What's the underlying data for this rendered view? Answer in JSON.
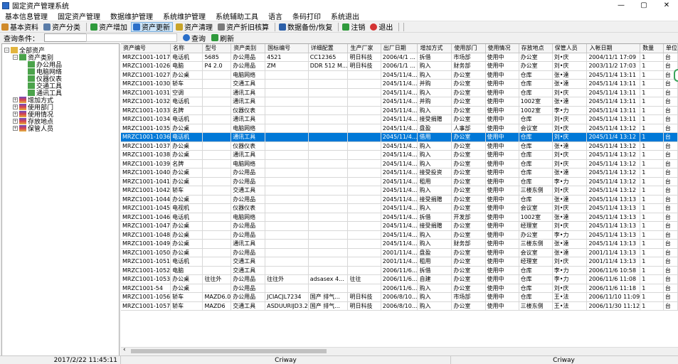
{
  "window": {
    "title": "固定资产管理系统",
    "min": "—",
    "max": "▢",
    "close": "✕"
  },
  "menu": [
    "基本信息管理",
    "固定资产管理",
    "数据维护管理",
    "系统维护管理",
    "系统辅助工具",
    "语言",
    "条码打印",
    "系统退出"
  ],
  "toolbar": [
    {
      "label": "基本资料",
      "icon": "user-group-icon",
      "color": "#d08a2a"
    },
    {
      "label": "资产分类",
      "icon": "gear-icon",
      "color": "#5a7ca8"
    },
    {
      "label": "资产增加",
      "icon": "add-box-icon",
      "color": "#2f9a3c"
    },
    {
      "label": "资产更新",
      "icon": "refresh-icon",
      "color": "#2a6fc9"
    },
    {
      "label": "资产清理",
      "icon": "cleanup-icon",
      "color": "#c8a42a"
    },
    {
      "label": "资产折旧核算",
      "icon": "calculate-icon",
      "color": "#7b7b7b"
    },
    {
      "label": "数据备份/恢复",
      "icon": "database-icon",
      "color": "#2c5fa8"
    },
    {
      "label": "注销",
      "icon": "logoff-icon",
      "color": "#2f9a3c"
    },
    {
      "label": "退出",
      "icon": "exit-icon",
      "color": "#d43333"
    }
  ],
  "query": {
    "label": "查询条件：",
    "search_label": "查询",
    "refresh_label": "刷新",
    "dropdown_arrow": "▾"
  },
  "tree": {
    "root": "全部资产",
    "category": "资产类别",
    "children": [
      "办公用品",
      "电脑网络",
      "仪器仪表",
      "交通工具",
      "通讯工具"
    ],
    "groups": [
      "增加方式",
      "使用部门",
      "使用情况",
      "存放地点",
      "保管人员"
    ]
  },
  "grid": {
    "columns": [
      "资产编号",
      "名称",
      "型号",
      "资产类别",
      "国标编号",
      "详细配置",
      "生产厂家",
      "出厂日期",
      "增加方式",
      "使用部门",
      "使用情况",
      "存放地点",
      "保管人员",
      "入帐日期",
      "数量",
      "单位"
    ],
    "selected_index": 9,
    "rows": [
      [
        "MRZC1001-1017",
        "电话机",
        "5685",
        "办公用品",
        "4521",
        "CC12365",
        "明日科技",
        "2006/4/1 ...",
        "拆借",
        "市场部",
        "使用中",
        "办公室",
        "刘•庆",
        "2004/11/1 17:09",
        "1",
        "台"
      ],
      [
        "MRZC1001-1026",
        "电脑",
        "P4 2.0",
        "办公用品",
        "ZM",
        "DDR 512 M...",
        "明日科技",
        "2006/1/1 ...",
        "购入",
        "财务部",
        "使用中",
        "办公室",
        "刘•庆",
        "2003/11/2 17:03",
        "1",
        "台"
      ],
      [
        "MRZC1001-1027",
        "办公桌",
        "",
        "电脑网络",
        "",
        "",
        "",
        "2045/11/4...",
        "购入",
        "办公室",
        "使用中",
        "仓库",
        "张•達",
        "2045/11/4 13:11",
        "1",
        "台"
      ],
      [
        "MRZC1001-1030",
        "轿车",
        "",
        "交通工具",
        "",
        "",
        "",
        "2045/11/4...",
        "并购",
        "办公室",
        "使用中",
        "仓库",
        "张•達",
        "2045/11/4 13:11",
        "1",
        "台"
      ],
      [
        "MRZC1001-1031",
        "空调",
        "",
        "通讯工具",
        "",
        "",
        "",
        "2045/11/4...",
        "购入",
        "办公室",
        "使用中",
        "仓库",
        "刘•庆",
        "2045/11/4 13:11",
        "1",
        "台"
      ],
      [
        "MRZC1001-1032",
        "电话机",
        "",
        "通讯工具",
        "",
        "",
        "",
        "2045/11/4...",
        "并购",
        "办公室",
        "使用中",
        "1002室",
        "张•達",
        "2045/11/4 13:11",
        "1",
        "台"
      ],
      [
        "MRZC1001-1033",
        "名牌",
        "",
        "仪器仪表",
        "",
        "",
        "",
        "2045/11/4...",
        "购入",
        "办公室",
        "使用中",
        "1002室",
        "李•力",
        "2045/11/4 13:11",
        "1",
        "台"
      ],
      [
        "MRZC1001-1034",
        "电话机",
        "",
        "通讯工具",
        "",
        "",
        "",
        "2045/11/4...",
        "接受捐赠",
        "办公室",
        "使用中",
        "仓库",
        "刘•庆",
        "2045/11/4 13:11",
        "1",
        "台"
      ],
      [
        "MRZC1001-1035",
        "办公桌",
        "",
        "电脑网络",
        "",
        "",
        "",
        "2045/11/4...",
        "盘盈",
        "人事部",
        "使用中",
        "会议室",
        "刘•庆",
        "2045/11/4 13:12",
        "1",
        "台"
      ],
      [
        "MRZC1001-1036",
        "电话机",
        "",
        "通讯工具",
        "",
        "",
        "",
        "2045/11/4...",
        "借用",
        "办公室",
        "使用中",
        "仓库",
        "刘•庆",
        "2045/11/4 13:12",
        "1",
        "台"
      ],
      [
        "MRZC1001-1037",
        "办公桌",
        "",
        "仪器仪表",
        "",
        "",
        "",
        "2045/11/4...",
        "购入",
        "办公室",
        "使用中",
        "仓库",
        "张•達",
        "2045/11/4 13:12",
        "1",
        "台"
      ],
      [
        "MRZC1001-1038",
        "办公桌",
        "",
        "通讯工具",
        "",
        "",
        "",
        "2045/11/4...",
        "购入",
        "办公室",
        "使用中",
        "仓库",
        "刘•庆",
        "2045/11/4 13:12",
        "1",
        "台"
      ],
      [
        "MRZC1001-1039",
        "名牌",
        "",
        "电脑网络",
        "",
        "",
        "",
        "2045/11/4...",
        "购入",
        "办公室",
        "使用中",
        "仓库",
        "刘•庆",
        "2045/11/4 13:12",
        "1",
        "台"
      ],
      [
        "MRZC1001-1040",
        "办公桌",
        "",
        "办公用品",
        "",
        "",
        "",
        "2045/11/4...",
        "接受投资",
        "办公室",
        "使用中",
        "仓库",
        "张•達",
        "2045/11/4 13:12",
        "1",
        "台"
      ],
      [
        "MRZC1001-1041",
        "办公桌",
        "",
        "办公用品",
        "",
        "",
        "",
        "2045/11/4...",
        "租用",
        "办公室",
        "使用中",
        "仓库",
        "李•力",
        "2045/11/4 13:12",
        "1",
        "台"
      ],
      [
        "MRZC1001-1042",
        "轿车",
        "",
        "交通工具",
        "",
        "",
        "",
        "2045/11/4...",
        "购入",
        "办公室",
        "使用中",
        "三楼东侧",
        "刘•庆",
        "2045/11/4 13:12",
        "1",
        "台"
      ],
      [
        "MRZC1001-1044",
        "办公桌",
        "",
        "办公用品",
        "",
        "",
        "",
        "2045/11/4...",
        "接受捐赠",
        "办公室",
        "使用中",
        "仓库",
        "张•達",
        "2045/11/4 13:13",
        "1",
        "台"
      ],
      [
        "MRZC1001-1045",
        "电视机",
        "",
        "仪器仪表",
        "",
        "",
        "",
        "2045/11/4...",
        "购入",
        "办公室",
        "使用中",
        "会议室",
        "刘•庆",
        "2045/11/4 13:13",
        "1",
        "台"
      ],
      [
        "MRZC1001-1046",
        "电话机",
        "",
        "电脑网络",
        "",
        "",
        "",
        "2045/11/4...",
        "拆借",
        "开发部",
        "使用中",
        "1002室",
        "张•達",
        "2045/11/4 13:13",
        "1",
        "台"
      ],
      [
        "MRZC1001-1047",
        "办公桌",
        "",
        "办公用品",
        "",
        "",
        "",
        "2045/11/4...",
        "接受捐赠",
        "办公室",
        "使用中",
        "经理室",
        "刘•庆",
        "2045/11/4 13:13",
        "1",
        "台"
      ],
      [
        "MRZC1001-1048",
        "办公桌",
        "",
        "办公用品",
        "",
        "",
        "",
        "2045/11/4...",
        "购入",
        "办公室",
        "使用中",
        "办公室",
        "李•力",
        "2045/11/4 13:13",
        "1",
        "台"
      ],
      [
        "MRZC1001-1049",
        "办公桌",
        "",
        "通讯工具",
        "",
        "",
        "",
        "2045/11/4...",
        "购入",
        "财务部",
        "使用中",
        "三楼东侧",
        "张•達",
        "2045/11/4 13:13",
        "1",
        "台"
      ],
      [
        "MRZC1001-1050",
        "办公桌",
        "",
        "办公用品",
        "",
        "",
        "",
        "2001/11/4...",
        "盘盈",
        "办公室",
        "使用中",
        "会议室",
        "张•達",
        "2001/11/4 13:13",
        "1",
        "台"
      ],
      [
        "MRZC1001-1051",
        "电话机",
        "",
        "交通工具",
        "",
        "",
        "",
        "2001/11/4...",
        "租用",
        "办公室",
        "使用中",
        "经理室",
        "刘•庆",
        "2001/11/4 13:13",
        "1",
        "台"
      ],
      [
        "MRZC1001-1052",
        "电脑",
        "",
        "交通工具",
        "",
        "",
        "",
        "2006/11/6...",
        "拆借",
        "办公室",
        "使用中",
        "仓库",
        "李•力",
        "2006/11/6 10:58",
        "1",
        "台"
      ],
      [
        "MRZC1001-1053",
        "办公桌",
        "往往外",
        "办公用品",
        "往往外",
        "adsasex 4...",
        "往往",
        "2006/11/6...",
        "自建",
        "办公室",
        "使用中",
        "仓库",
        "李•力",
        "2006/11/6 11:08",
        "1",
        "台"
      ],
      [
        "MRZC1001-54",
        "办公桌",
        "",
        "办公用品",
        "",
        "",
        "",
        "2006/11/6...",
        "购入",
        "办公室",
        "使用中",
        "仓库",
        "刘•庆",
        "2006/11/6 11:18",
        "1",
        "台"
      ],
      [
        "MRZC1001-1056",
        "轿车",
        "MAZD6.0",
        "办公用品",
        "JCIACJL7234",
        "国产 排气...",
        "明日科技",
        "2006/8/10...",
        "购入",
        "市场部",
        "使用中",
        "仓库",
        "王•法",
        "2006/11/10 11:09",
        "1",
        "台"
      ],
      [
        "MRZC1001-1057",
        "轿车",
        "MAZD6",
        "交通工具",
        "ASDUURIJD3.2",
        "国产 排气...",
        "明日科技",
        "2006/8/10...",
        "购入",
        "办公室",
        "使用中",
        "三楼东侧",
        "王•法",
        "2006/11/30 11:12",
        "1",
        "台"
      ]
    ]
  },
  "status": {
    "datetime": "2017/2/22 11:45:11",
    "company": "Criway",
    "user": "Criway"
  }
}
